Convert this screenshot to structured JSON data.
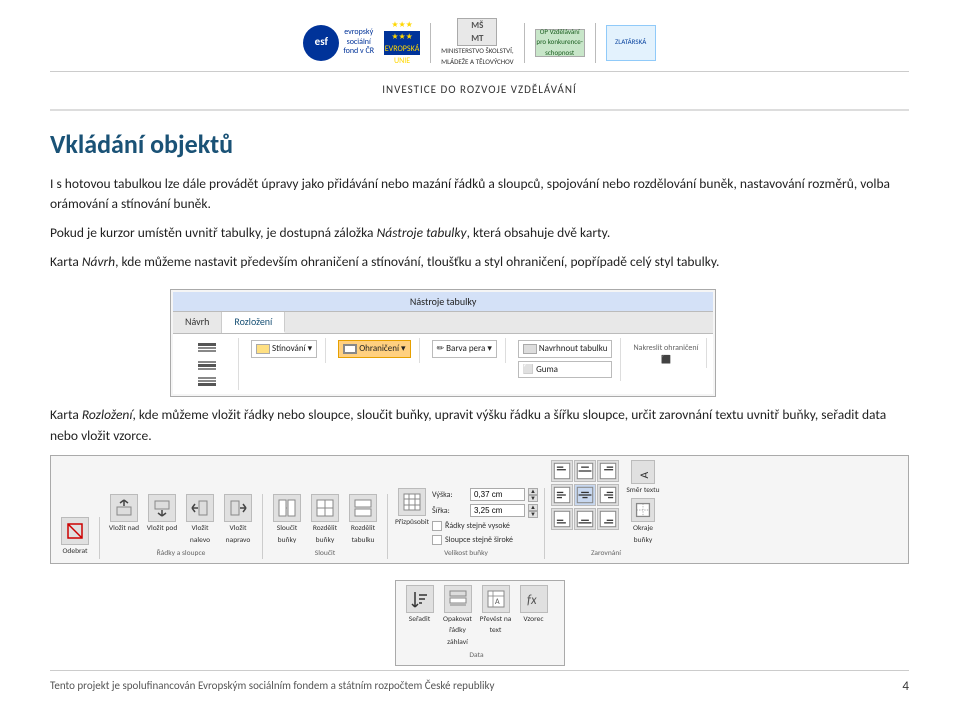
{
  "header": {
    "investice_text": "INVESTICE DO ROZVOJE VZDĚLÁVÁNÍ"
  },
  "logos": {
    "esf": "esf",
    "evropska_unie": "EVROPSKÁ UNIE",
    "msmt": "MŠ MT",
    "msmt_full": "MINISTERSTVO ŠKOLSTVÍ, MLÁDEŽE A TĚLOVÝCHOV",
    "op": "OP Vzdělávání pro konkurenceschopnost",
    "zlatarska": "ZLATÁRSKÁ"
  },
  "title": "Vkládání objektů",
  "paragraph1": "I s hotovou tabulkou lze dále provádět úpravy jako přidávání nebo mazání řádků a sloupců, spojování nebo rozdělování buněk, nastavování rozměrů, volba orámování a stínování buněk.",
  "paragraph2": "Pokud je kurzor umístěn uvnitř tabulky, je dostupná záložka Nástroje tabulky, která obsahuje dvě karty.",
  "paragraph3": "Karta Návrh, kde můžeme nastavit především ohraničení a stínování, tloušťku a styl ohraničení, popřípadě celý styl tabulky.",
  "ribbon1": {
    "title": "Nástroje tabulky",
    "tabs": [
      "Návrh",
      "Rozložení"
    ],
    "active_tab": "Rozložení",
    "groups": {
      "stínovani": "Stínování",
      "ohraniceni": "Ohraničení",
      "barva_pera": "Barva pera",
      "navrhnout": "Navrhnout tabulku",
      "guma": "Guma",
      "nakreslit": "Nakreslit ohraničení"
    }
  },
  "paragraph4": "Karta Rozložení, kde můžeme vložit řádky nebo sloupce, sloučit buňky, upravit výšku řádku a šířku sloupce, určit zarovnání textu uvnitř buňky, seřadit data nebo vložit vzorce.",
  "toolbar": {
    "groups": {
      "radky_sloupce": {
        "label": "Řádky a sloupce",
        "buttons": [
          "Odebrat",
          "Vložit nad",
          "Vložit pod",
          "Vložit nalevo",
          "Vložit napravo"
        ]
      },
      "sloucit": {
        "label": "Sloučit",
        "buttons": [
          "Sloučit buňky",
          "Rozdělit buňky",
          "Rozdělit tabulku"
        ]
      },
      "velikost": {
        "label": "Velikost buňky",
        "buttons": [
          "Přizpůsobit"
        ],
        "inputs": {
          "vyska_label": "Výška:",
          "vyska_val": "0,37 cm",
          "sirka_label": "Šířka:",
          "sirka_val": "3,25 cm"
        },
        "checkboxes": [
          "Řádky stejně vysoké",
          "Sloupce stejně široké"
        ]
      },
      "zarovnani": {
        "label": "Zarovnání",
        "buttons": [
          "Směr textu",
          "Okraje buňky"
        ]
      }
    }
  },
  "sort_group": {
    "label": "Data",
    "buttons": [
      "Seřadit",
      "Opakovat řádky záhlaví",
      "Převést na text",
      "Vzorec"
    ]
  },
  "footer": {
    "text": "Tento projekt je spolufinancován Evropským sociálním fondem a státním rozpočtem České republiky",
    "page": "4"
  }
}
